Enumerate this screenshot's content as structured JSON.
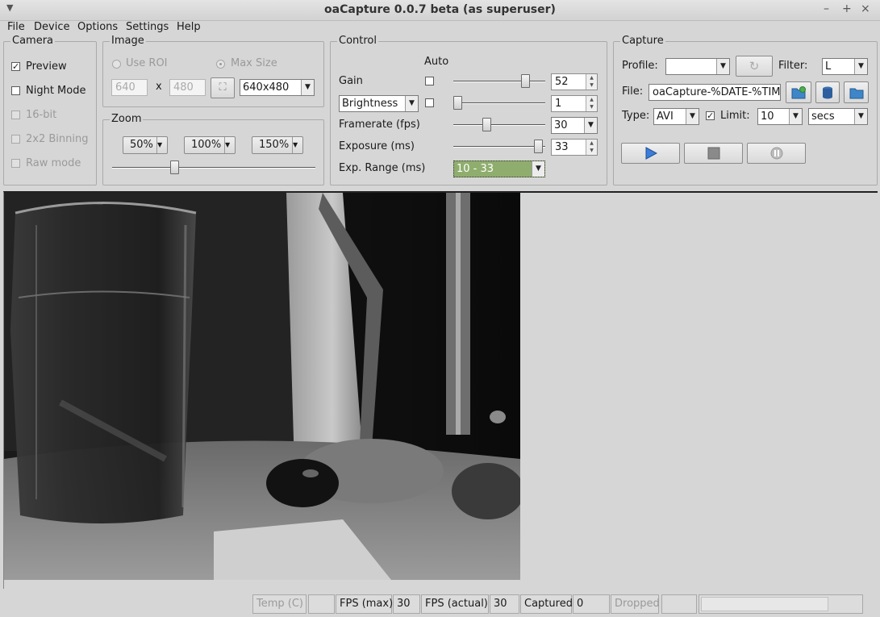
{
  "window": {
    "title": "oaCapture 0.0.7 beta (as superuser)"
  },
  "menu": [
    "File",
    "Device",
    "Options",
    "Settings",
    "Help"
  ],
  "camera": {
    "title": "Camera",
    "preview": {
      "label": "Preview",
      "checked": true
    },
    "night_mode": {
      "label": "Night Mode",
      "checked": false
    },
    "bit16": {
      "label": "16-bit"
    },
    "binning": {
      "label": "2x2 Binning"
    },
    "raw_mode": {
      "label": "Raw mode"
    }
  },
  "image": {
    "title": "Image",
    "use_roi": "Use ROI",
    "max_size": "Max Size",
    "width": "640",
    "x_sep": "x",
    "height": "480",
    "resolution": "640x480"
  },
  "zoom": {
    "title": "Zoom",
    "options": [
      "50%",
      "100%",
      "150%"
    ],
    "slider_level": 0.3
  },
  "control": {
    "title": "Control",
    "auto_label": "Auto",
    "gain": {
      "label": "Gain",
      "value": "52",
      "level": 0.82
    },
    "brightness": {
      "label": "Brightness",
      "value": "1",
      "level": 0.0
    },
    "framerate": {
      "label": "Framerate (fps)",
      "value": "30",
      "level": 0.35
    },
    "exposure": {
      "label": "Exposure (ms)",
      "value": "33",
      "level": 0.97
    },
    "exp_range": {
      "label": "Exp. Range (ms)",
      "value": "10 - 33"
    }
  },
  "capture": {
    "title": "Capture",
    "profile_label": "Profile:",
    "profile_value": "",
    "filter_label": "Filter:",
    "filter_value": "L",
    "file_label": "File:",
    "file_value": "oaCapture-%DATE-%TIME",
    "type_label": "Type:",
    "type_value": "AVI",
    "limit_label": "Limit:",
    "limit_checked": true,
    "limit_value": "10",
    "limit_unit": "secs"
  },
  "statusbar": {
    "temp_label": "Temp (C)",
    "temp_value": "",
    "fps_max_label": "FPS (max)",
    "fps_max_value": "30",
    "fps_actual_label": "FPS (actual)",
    "fps_actual_value": "30",
    "captured_label": "Captured",
    "captured_value": "0",
    "dropped_label": "Dropped",
    "dropped_value": ""
  },
  "colors": {
    "exp_range_bg": "#8fae6e",
    "play_icon": "#3b7dd8",
    "folder_icon": "#3f86c9"
  }
}
